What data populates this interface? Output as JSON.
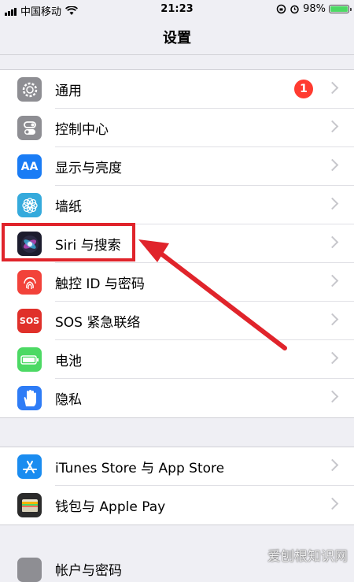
{
  "status_bar": {
    "carrier": "中国移动",
    "time": "21:23",
    "battery_percent": "98%",
    "battery_level": 0.98
  },
  "nav": {
    "title": "设置"
  },
  "group1": [
    {
      "label": "通用",
      "icon": "gear-icon",
      "color": "#8e8e93",
      "badge": "1"
    },
    {
      "label": "控制中心",
      "icon": "control-center-icon",
      "color": "#8e8e93"
    },
    {
      "label": "显示与亮度",
      "icon": "display-aa-icon",
      "color": "#1a7cf5"
    },
    {
      "label": "墙纸",
      "icon": "wallpaper-flower-icon",
      "color": "#35aadc"
    },
    {
      "label": "Siri 与搜索",
      "icon": "siri-icon",
      "color": "#1c1c2e"
    },
    {
      "label": "触控 ID 与密码",
      "icon": "fingerprint-icon",
      "color": "#f2423a"
    },
    {
      "label": "SOS 紧急联络",
      "icon": "sos-icon",
      "color": "#e0302a",
      "icon_text": "SOS"
    },
    {
      "label": "电池",
      "icon": "battery-icon",
      "color": "#4cd964"
    },
    {
      "label": "隐私",
      "icon": "hand-icon",
      "color": "#2e7cf6"
    }
  ],
  "group2": [
    {
      "label": "iTunes Store 与 App Store",
      "icon": "app-store-icon",
      "color": "#1a8cf0"
    },
    {
      "label": "钱包与 Apple Pay",
      "icon": "wallet-icon",
      "color": "#2b2b2b"
    }
  ],
  "peek": {
    "label": "帐户与密码"
  },
  "watermark": "爱刨根知识网",
  "colors": {
    "annotation_red": "#e0242b",
    "background": "#efeff4"
  }
}
